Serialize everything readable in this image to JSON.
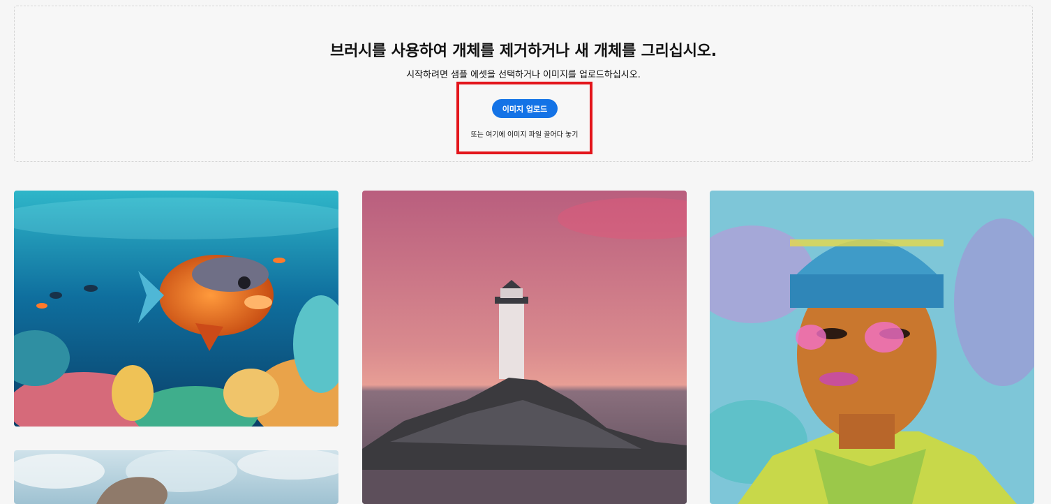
{
  "header": {
    "title": "브러시를 사용하여 개체를 제거하거나 새 개체를 그리십시오.",
    "subtitle": "시작하려면 샘플 에셋을 선택하거나 이미지를 업로드하십시오."
  },
  "upload": {
    "button_label": "이미지 업로드",
    "drop_hint": "또는 여기에 이미지 파일 끌어다 놓기"
  },
  "colors": {
    "accent": "#1473e6",
    "highlight": "#e3151b"
  },
  "samples": [
    {
      "name": "underwater-fish",
      "type": "image"
    },
    {
      "name": "lighthouse-sunset",
      "type": "image"
    },
    {
      "name": "portrait-beanie",
      "type": "image"
    },
    {
      "name": "sky-landscape",
      "type": "image"
    }
  ]
}
